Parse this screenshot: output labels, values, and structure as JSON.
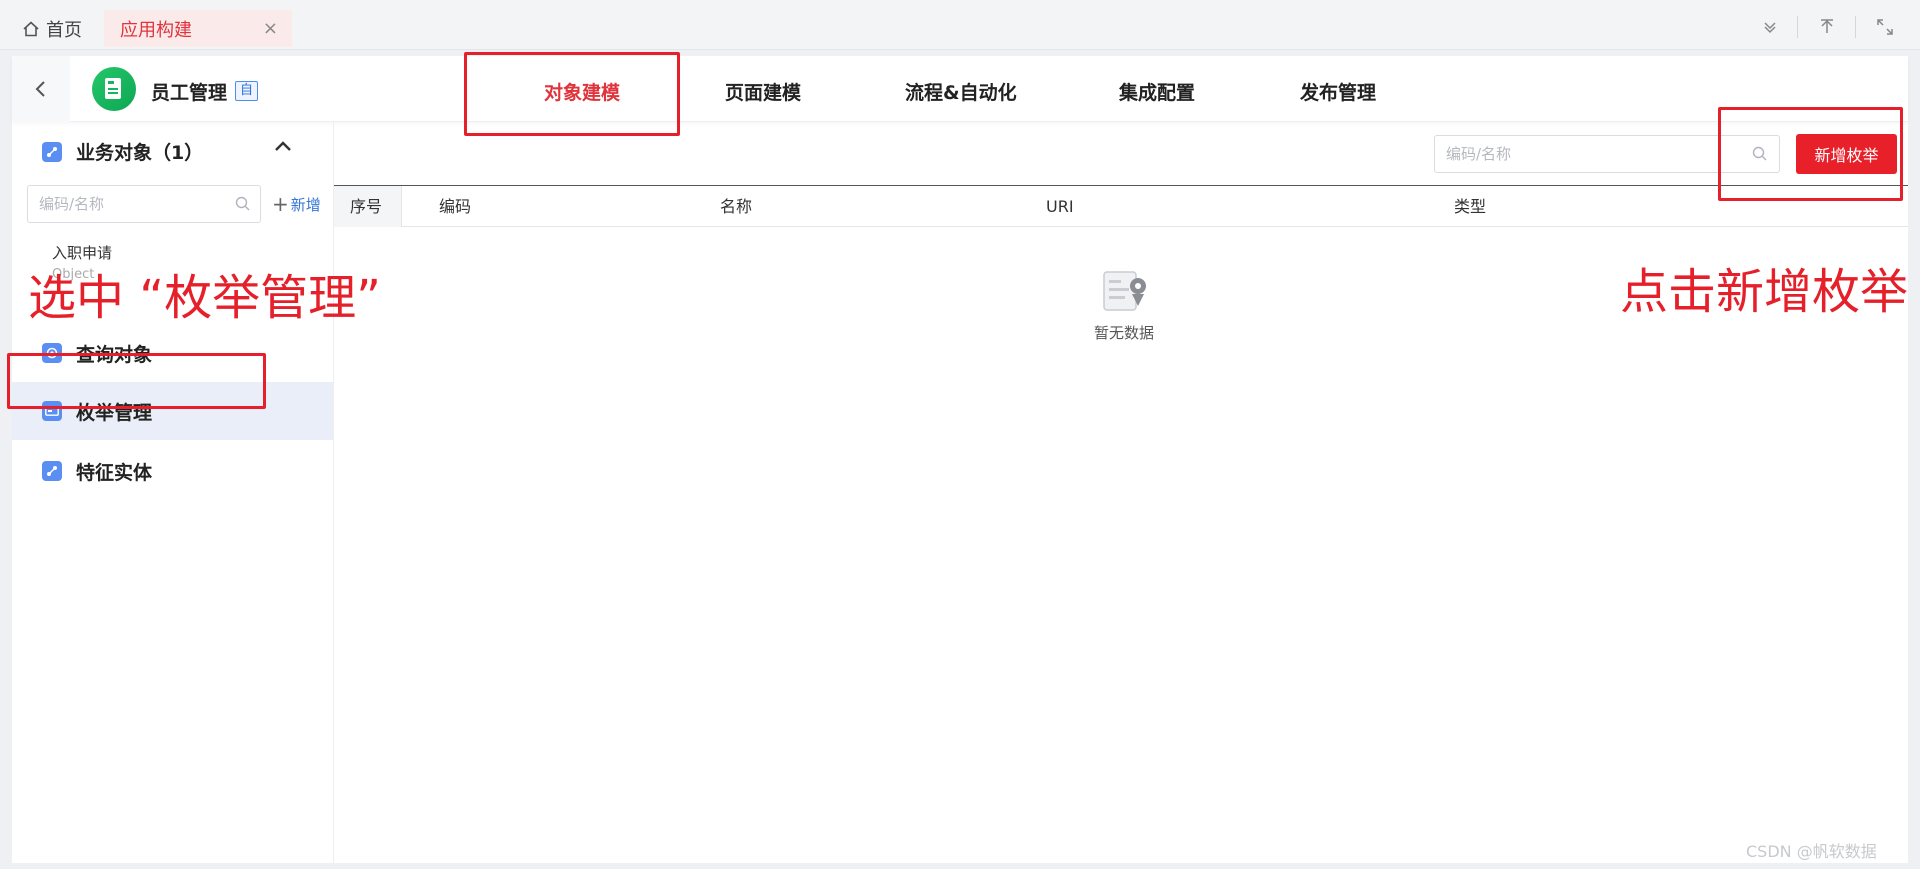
{
  "tabs": {
    "home_label": "首页",
    "active_label": "应用构建",
    "close_glyph": "×"
  },
  "app": {
    "name": "员工管理",
    "badge": "自"
  },
  "nav": [
    {
      "label": "对象建模",
      "active": true
    },
    {
      "label": "页面建模",
      "active": false
    },
    {
      "label": "流程&自动化",
      "active": false
    },
    {
      "label": "集成配置",
      "active": false
    },
    {
      "label": "发布管理",
      "active": false
    }
  ],
  "sidebar": {
    "group_title": "业务对象（1）",
    "search_placeholder": "编码/名称",
    "add_label": "新增",
    "sub_item": "入职申请",
    "sub_item_faint": "Object",
    "items": [
      {
        "label": "查询对象",
        "icon": "query-object-icon"
      },
      {
        "label": "枚举管理",
        "icon": "enum-icon"
      },
      {
        "label": "特征实体",
        "icon": "feature-entity-icon"
      }
    ]
  },
  "content": {
    "search_placeholder": "编码/名称",
    "add_button": "新增枚举",
    "columns": [
      "序号",
      "编码",
      "名称",
      "URI",
      "类型"
    ],
    "empty_text": "暂无数据"
  },
  "annotations": {
    "select_text": "选中 “枚举管理”",
    "click_text": "点击新增枚举"
  },
  "watermark": "CSDN @帆软数据"
}
